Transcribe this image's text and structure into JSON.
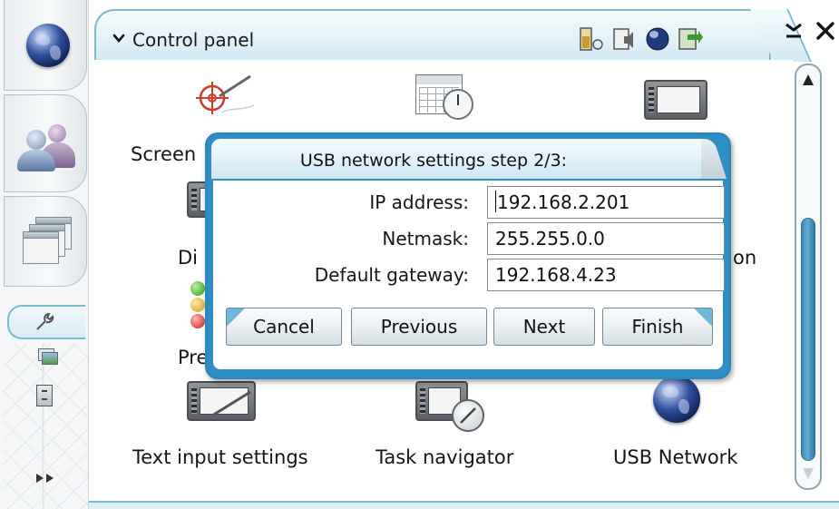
{
  "titlebar": {
    "title": "Control panel",
    "status_icons": [
      "battery-icon",
      "volume-icon",
      "internet-connection-icon",
      "usb-exit-icon"
    ],
    "minimize_icon": "minimize-icon",
    "close_icon": "close-icon"
  },
  "navigator": {
    "items": [
      "web-browser-icon",
      "contacts-icon",
      "applications-icon"
    ],
    "tray": [
      "control-panel-icon",
      "image-viewer-icon",
      "file-manager-icon"
    ],
    "more_icon": "more-arrows-icon"
  },
  "control_panel": {
    "items": [
      {
        "label": "Screen",
        "icon": "screen-calibration-icon"
      },
      {
        "label": "",
        "icon": "date-time-icon"
      },
      {
        "label": "",
        "icon": "device-settings-icon"
      },
      {
        "label": "Di",
        "icon": "display-icon"
      },
      {
        "label": "on",
        "icon": "connectivity-icon"
      },
      {
        "label": "Pre",
        "icon": "presence-icon"
      },
      {
        "label": "Text input settings",
        "icon": "text-input-icon"
      },
      {
        "label": "Task navigator",
        "icon": "task-navigator-icon"
      },
      {
        "label": "USB Network",
        "icon": "usb-network-globe-icon"
      }
    ]
  },
  "dialog": {
    "title": "USB network settings step 2/3:",
    "fields": [
      {
        "label": "IP address:",
        "value": "192.168.2.201",
        "focused": true
      },
      {
        "label": "Netmask:",
        "value": "255.255.0.0",
        "focused": false
      },
      {
        "label": "Default gateway:",
        "value": "192.168.4.23",
        "focused": false
      }
    ],
    "buttons": {
      "cancel": "Cancel",
      "previous": "Previous",
      "next": "Next",
      "finish": "Finish"
    }
  },
  "colors": {
    "accent": "#2f8fc4",
    "frame": "#7bb8d3",
    "scroll_thumb": "#3a86b3"
  }
}
